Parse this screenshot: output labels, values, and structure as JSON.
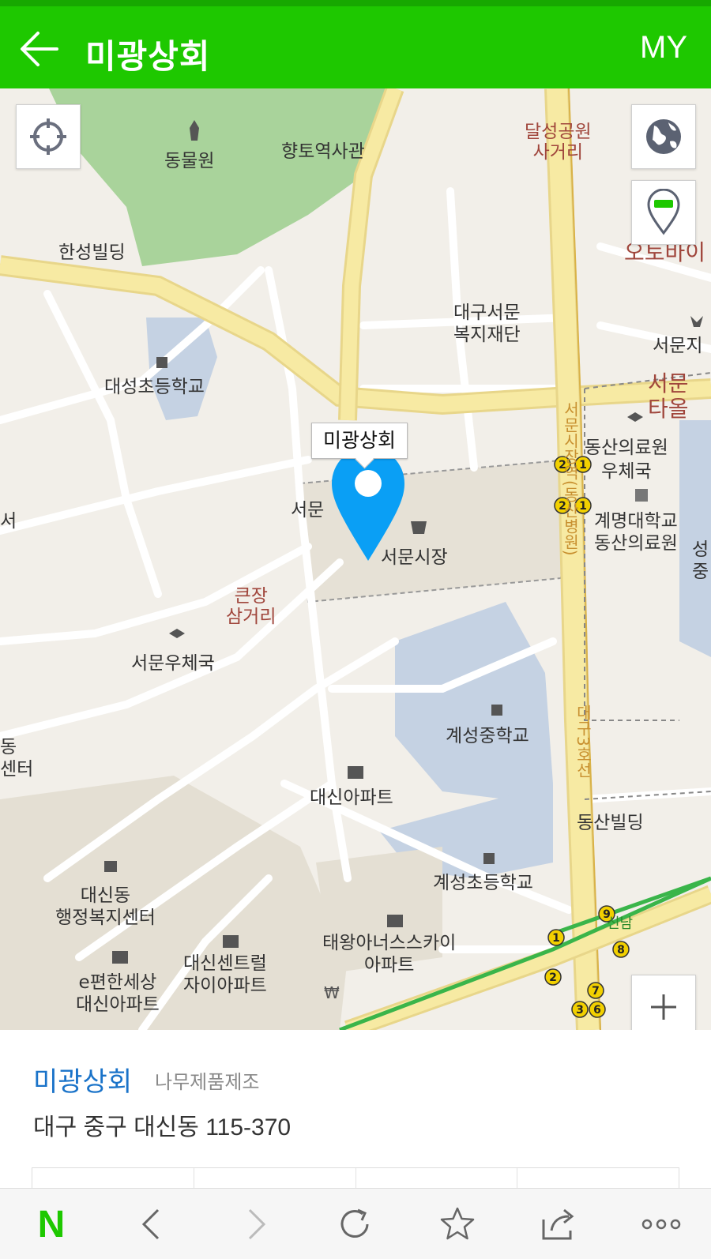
{
  "header": {
    "title": "미광상회",
    "my_label": "MY"
  },
  "map": {
    "callout": "미광상회",
    "labels": {
      "zoo": "동물원",
      "history_hall": "향토역사관",
      "dalseong_park_intersection": "달성공원\n사거리",
      "hansung_building": "한성빌딩",
      "otobai": "오토바이",
      "daegu_seomun_welfare": "대구서문\n복지재단",
      "seomun_area": "서문지",
      "daesung_elementary": "대성초등학교",
      "seomun_tower": "서문\n타올",
      "dongsan_post": "동산의료원\n우체국",
      "seomun_partial": "서문",
      "keimyung_dongsan": "계명대학교\n동산의료원",
      "seomun_market": "서문시장",
      "keunjang_intersection": "큰장\n삼거리",
      "seomun_post": "서문우체국",
      "keisung_middle": "계성중학교",
      "dong_center_partial": "동\n센터",
      "daesin_apt": "대신아파트",
      "dongsan_building": "동산빌딩",
      "keisung_elementary": "계성초등학교",
      "daesin_admin": "대신동\n행정복지센터",
      "taewang_apt": "태왕아너스스카이\n아파트",
      "daesin_xi": "대신센트럴\n자이아파트",
      "e_pyeonhan": "e편한세상\n대신아파트",
      "seomunro_vertical": "서문시장역(동산병원)",
      "daegu3ho_vertical": "대구3호선",
      "sin_partial": "신남",
      "edge_partial_left": "서",
      "edge_partial_right": "성\n중"
    },
    "subway_markers": [
      "2",
      "1",
      "2",
      "1",
      "9",
      "1",
      "8",
      "2",
      "7",
      "3",
      "6"
    ],
    "controls": {
      "locate_icon": "crosshair-icon",
      "globe_icon": "globe-icon",
      "pin_toggle_icon": "map-pin-minus-icon",
      "zoom_in": "+",
      "zoom_out": "−"
    },
    "colors": {
      "park": "#a9d39b",
      "water_zone": "#c5d2e3",
      "major_road": "#f7eaa3",
      "road_edge": "#e8d68a",
      "subway": "#3ab54a",
      "pin": "#0a9ff5"
    }
  },
  "place": {
    "name": "미광상회",
    "category": "나무제품제조",
    "address": "대구 중구 대신동 115-370"
  },
  "browser_bar": {
    "logo": "N",
    "icons": [
      "naver-logo-icon",
      "back-icon",
      "forward-icon",
      "refresh-icon",
      "star-icon",
      "share-icon",
      "more-icon"
    ]
  },
  "colors": {
    "header": "#1ec800",
    "place_name": "#1a73c9"
  }
}
